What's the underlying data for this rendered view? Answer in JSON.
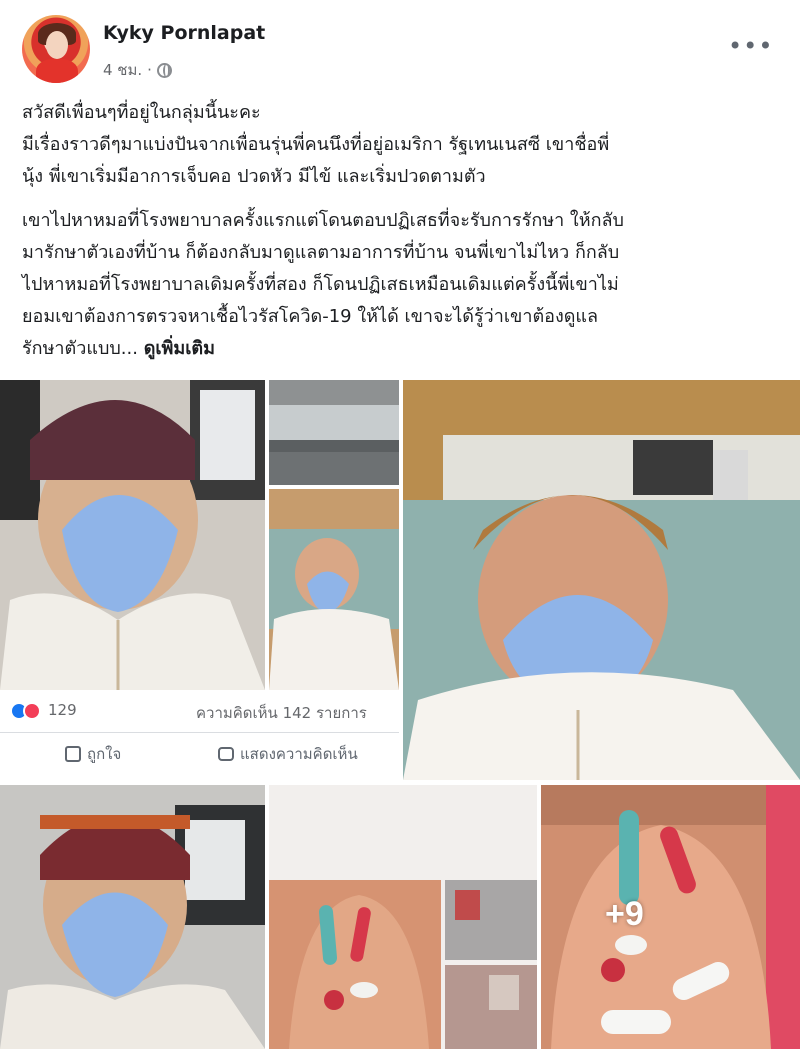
{
  "author": {
    "name": "Kyky Pornlapat",
    "time": "4 ชม.",
    "separator": "·"
  },
  "post": {
    "paragraph1": "สวัสดีเพื่อนๆที่อยู่ในกลุ่มนี้นะคะ\nมีเรื่องราวดีๆมาแบ่งปันจากเพื่อนรุ่นพี่คนนึงที่อยู่อเมริกา รัฐเทนเนสซี เขาชื่อพี่\nนุ้ง พี่เขาเริ่มมีอาการเจ็บคอ ปวดหัว มีไข้ และเริ่มปวดตามตัว",
    "paragraph2": "เขาไปหาหมอที่โรงพยาบาลครั้งแรกแต่โดนตอบปฏิเสธที่จะรับการรักษา ให้กลับ\nมารักษาตัวเองที่บ้าน ก็ต้องกลับมาดูแลตามอาการที่บ้าน จนพี่เขาไม่ไหว ก็กลับ\nไปหาหมอที่โรงพยาบาลเดิมครั้งที่สอง ก็โดนปฏิเสธเหมือนเดิมแต่ครั้งนี้พี่เขาไม่\nยอมเขาต้องการตรวจหาเชื้อไวรัสโควิด-19 ให้ได้ เขาจะได้รู้ว่าเขาต้องดูแล\nรักษาตัวแบบ...",
    "see_more": "ดูเพิ่มเติม"
  },
  "reactions": {
    "count": "129",
    "comments": "ความคิดเห็น 142 รายการ",
    "like_label": "ถูกใจ",
    "comment_label": "แสดงความคิดเห็น"
  },
  "gallery": {
    "more_count": "+9"
  },
  "colors": {
    "accent": "#1877f2",
    "love": "#f33e58",
    "mask": "#8fb4e8"
  }
}
